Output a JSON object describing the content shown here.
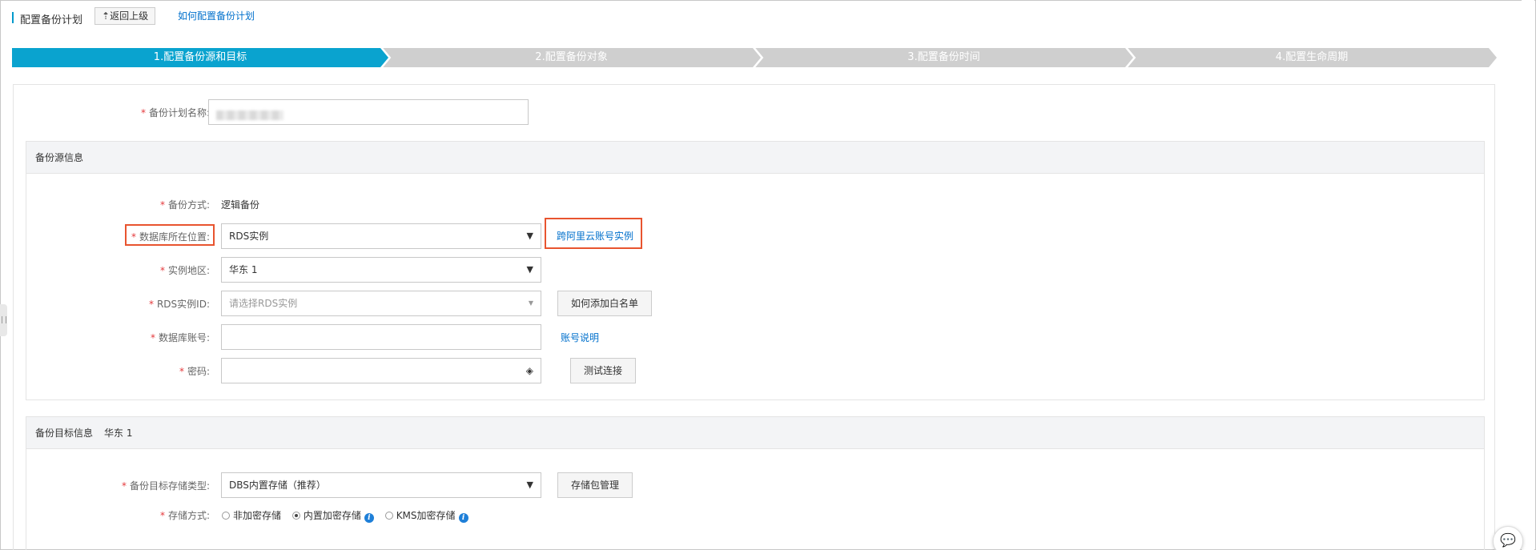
{
  "header": {
    "title": "配置备份计划",
    "back_label": "返回上级",
    "howto_link": "如何配置备份计划"
  },
  "steps": [
    {
      "label": "1.配置备份源和目标",
      "active": true
    },
    {
      "label": "2.配置备份对象",
      "active": false
    },
    {
      "label": "3.配置备份时间",
      "active": false
    },
    {
      "label": "4.配置生命周期",
      "active": false
    }
  ],
  "form": {
    "plan_name_label": "备份计划名称:",
    "source_section": {
      "title": "备份源信息",
      "backup_method_label": "备份方式:",
      "backup_method_value": "逻辑备份",
      "db_location_label": "数据库所在位置:",
      "db_location_value": "RDS实例",
      "cross_account_link": "跨阿里云账号实例",
      "region_label": "实例地区:",
      "region_value": "华东 1",
      "rds_id_label": "RDS实例ID:",
      "rds_id_placeholder": "请选择RDS实例",
      "whitelist_button": "如何添加白名单",
      "db_account_label": "数据库账号:",
      "account_help_link": "账号说明",
      "password_label": "密码:",
      "test_connection_button": "测试连接"
    },
    "target_section": {
      "title": "备份目标信息",
      "region": "华东 1",
      "storage_type_label": "备份目标存储类型:",
      "storage_type_value": "DBS内置存储（推荐）",
      "package_button": "存储包管理",
      "storage_mode_label": "存储方式:",
      "storage_options": [
        {
          "label": "非加密存储",
          "selected": false,
          "info": false
        },
        {
          "label": "内置加密存储",
          "selected": true,
          "info": true
        },
        {
          "label": "KMS加密存储",
          "selected": false,
          "info": true
        }
      ]
    }
  },
  "colors": {
    "active_step": "#0aa3cf",
    "inactive_step": "#cfcfcf",
    "highlight": "#e8542f",
    "link": "#0070cc",
    "required": "#e4393c"
  }
}
